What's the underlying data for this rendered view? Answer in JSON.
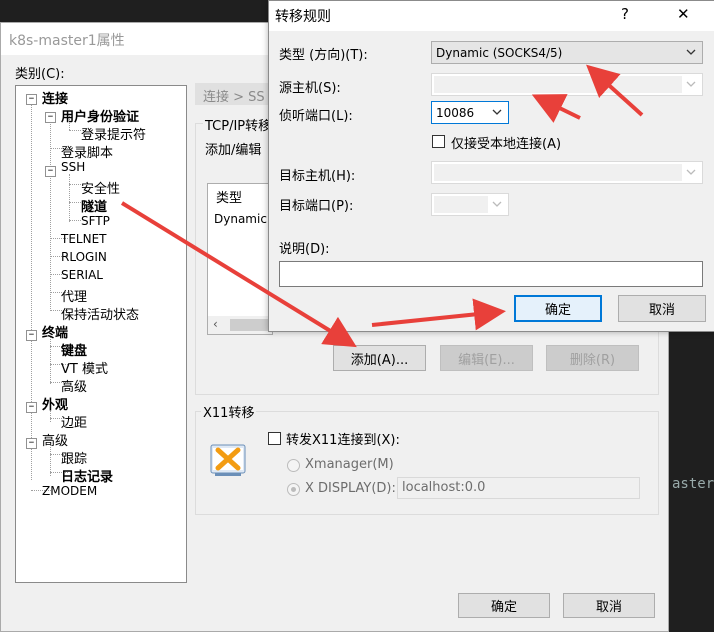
{
  "main_dialog": {
    "title": "k8s-master1属性",
    "category_label": "类别(C):",
    "breadcrumb": "连接 > SS",
    "tcp_group": "TCP/IP转移",
    "add_edit_text": "添加/编辑",
    "table_header_type": "类型",
    "table_row_type": "Dynamic",
    "add_button": "添加(A)...",
    "edit_button": "编辑(E)...",
    "delete_button": "删除(R)",
    "x11_group": "X11转移",
    "x11_forward_label": "转发X11连接到(X):",
    "xmanager_label": "Xmanager(M)",
    "xdisplay_label": "X DISPLAY(D):",
    "xdisplay_value": "localhost:0.0",
    "ok_button": "确定",
    "cancel_button": "取消"
  },
  "tree": {
    "items": [
      {
        "label": "连接",
        "bold": true
      },
      {
        "label": "用户身份验证",
        "bold": true
      },
      {
        "label": "登录提示符",
        "bold": false
      },
      {
        "label": "登录脚本",
        "bold": false
      },
      {
        "label": "SSH",
        "bold": false
      },
      {
        "label": "安全性",
        "bold": false
      },
      {
        "label": "隧道",
        "bold": true
      },
      {
        "label": "SFTP",
        "bold": false
      },
      {
        "label": "TELNET",
        "bold": false
      },
      {
        "label": "RLOGIN",
        "bold": false
      },
      {
        "label": "SERIAL",
        "bold": false
      },
      {
        "label": "代理",
        "bold": false
      },
      {
        "label": "保持活动状态",
        "bold": false
      },
      {
        "label": "终端",
        "bold": true
      },
      {
        "label": "键盘",
        "bold": true
      },
      {
        "label": "VT 模式",
        "bold": false
      },
      {
        "label": "高级",
        "bold": false
      },
      {
        "label": "外观",
        "bold": true
      },
      {
        "label": "边距",
        "bold": false
      },
      {
        "label": "高级",
        "bold": false
      },
      {
        "label": "跟踪",
        "bold": false
      },
      {
        "label": "日志记录",
        "bold": true
      },
      {
        "label": "ZMODEM",
        "bold": false
      }
    ]
  },
  "rule_dialog": {
    "title": "转移规则",
    "help": "?",
    "close": "✕",
    "type_label": "类型 (方向)(T):",
    "type_value": "Dynamic (SOCKS4/5)",
    "source_host_label": "源主机(S):",
    "listen_port_label": "侦听端口(L):",
    "listen_port_value": "10086",
    "local_only_label": "仅接受本地连接(A)",
    "target_host_label": "目标主机(H):",
    "target_port_label": "目标端口(P):",
    "description_label": "说明(D):",
    "ok_button": "确定",
    "cancel_button": "取消"
  },
  "terminal": {
    "fragment": "aster",
    "accent": "#e8403a"
  }
}
